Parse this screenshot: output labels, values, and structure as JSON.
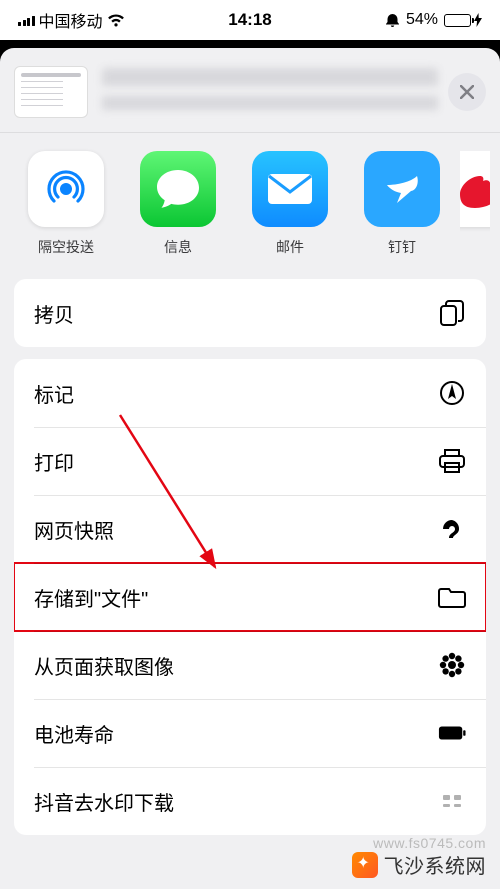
{
  "status": {
    "carrier": "中国移动",
    "time": "14:18",
    "battery_pct": "54%"
  },
  "apps": [
    {
      "key": "airdrop",
      "label": "隔空投送",
      "bg": "#ffffff",
      "fg": "#007aff"
    },
    {
      "key": "messages",
      "label": "信息",
      "bg": "linear-gradient(#5ff675,#0bc633)",
      "fg": "#ffffff"
    },
    {
      "key": "mail",
      "label": "邮件",
      "bg": "linear-gradient(#27c3ff,#0f8cff)",
      "fg": "#ffffff"
    },
    {
      "key": "dingtalk",
      "label": "钉钉",
      "bg": "#2aa7ff",
      "fg": "#ffffff"
    },
    {
      "key": "more",
      "label": "",
      "bg": "#ffffff",
      "fg": "#ff3b30"
    }
  ],
  "actions_group1": [
    {
      "key": "copy",
      "label": "拷贝"
    }
  ],
  "actions_group2": [
    {
      "key": "markup",
      "label": "标记",
      "highlight": false
    },
    {
      "key": "print",
      "label": "打印",
      "highlight": false
    },
    {
      "key": "snapshot",
      "label": "网页快照",
      "highlight": false
    },
    {
      "key": "save_to_files",
      "label": "存储到\"文件\"",
      "highlight": true
    },
    {
      "key": "get_image",
      "label": "从页面获取图像",
      "highlight": false
    },
    {
      "key": "battery_life",
      "label": "电池寿命",
      "highlight": false
    },
    {
      "key": "douyin_dl",
      "label": "抖音去水印下载",
      "highlight": false
    }
  ],
  "watermark": {
    "url": "www.fs0745.com",
    "brand": "飞沙系统网"
  }
}
